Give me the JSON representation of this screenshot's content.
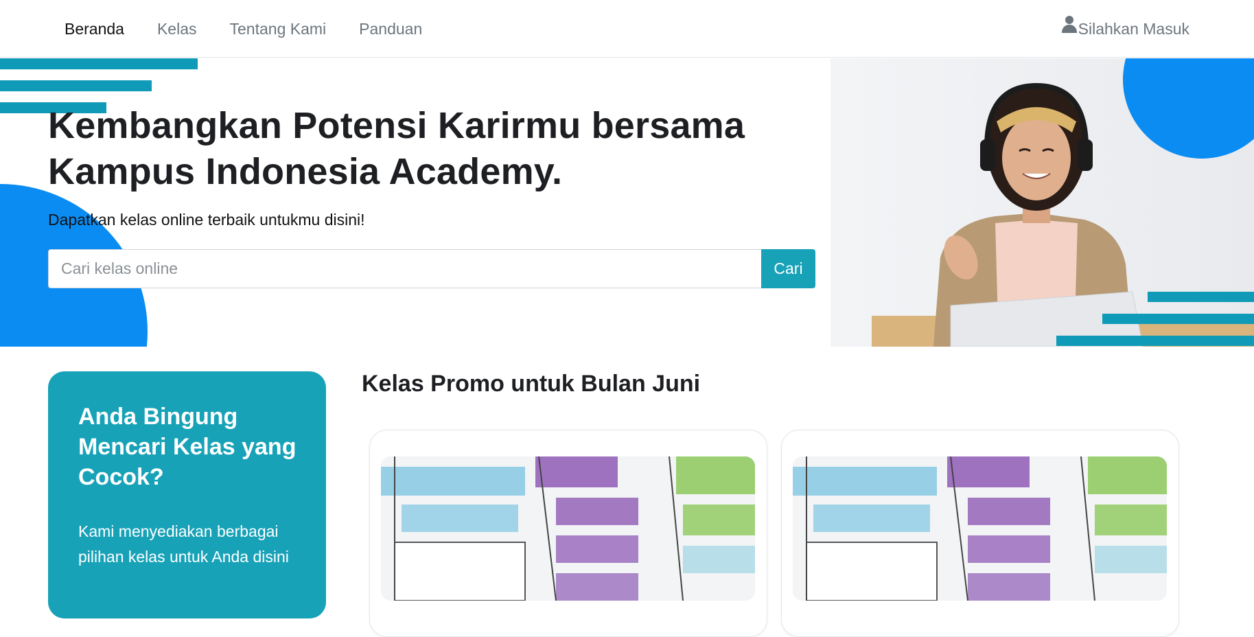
{
  "nav": {
    "links": [
      "Beranda",
      "Kelas",
      "Tentang Kami",
      "Panduan"
    ],
    "active": "Beranda",
    "login_label": "Silahkan Masuk"
  },
  "hero": {
    "title_line1": "Kembangkan Potensi Karirmu bersama",
    "title_line2": "Kampus Indonesia Academy.",
    "subtitle": "Dapatkan kelas online terbaik untukmu disini!",
    "search_placeholder": "Cari kelas online",
    "search_button": "Cari"
  },
  "info_card": {
    "title": "Anda Bingung Mencari Kelas yang Cocok?",
    "text": "Kami menyediakan berbagai pilihan kelas untuk Anda disini"
  },
  "promo": {
    "title": "Kelas Promo untuk Bulan Juni"
  },
  "colors": {
    "accent_teal": "#17a2b8",
    "stripe_teal": "#0f9ab7",
    "accent_blue": "#0a8cf2"
  },
  "icons": {
    "login": "user-icon"
  }
}
